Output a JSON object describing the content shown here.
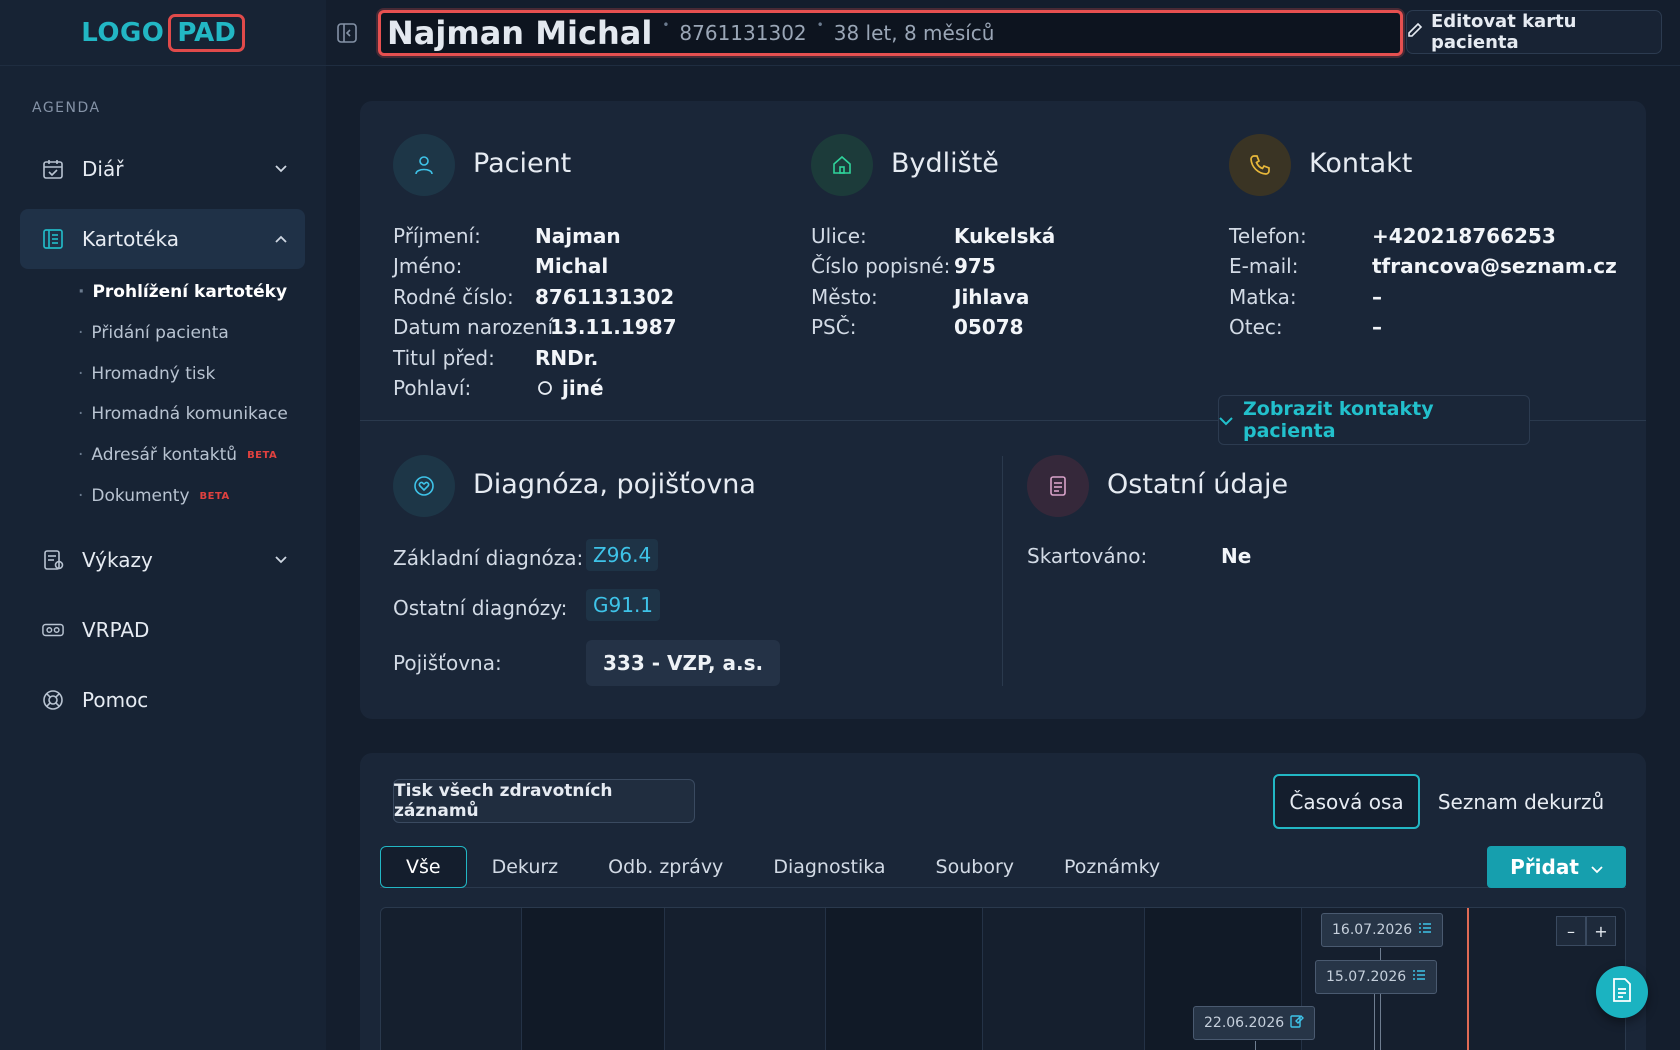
{
  "logo": {
    "part1": "LOGO",
    "part2": "PAD"
  },
  "sidebar": {
    "section": "AGENDA",
    "items": [
      {
        "label": "Diář"
      },
      {
        "label": "Kartotéka"
      },
      {
        "label": "Výkazy"
      },
      {
        "label": "VRPAD"
      },
      {
        "label": "Pomoc"
      }
    ],
    "subitems": [
      {
        "label": "Prohlížení kartotéky"
      },
      {
        "label": "Přidání pacienta"
      },
      {
        "label": "Hromadný tisk"
      },
      {
        "label": "Hromadná komunikace"
      },
      {
        "label": "Adresář kontaktů",
        "badge": "BETA"
      },
      {
        "label": "Dokumenty",
        "badge": "BETA"
      }
    ]
  },
  "header": {
    "name": "Najman Michal",
    "id": "8761131302",
    "age": "38 let, 8 měsíců",
    "edit_label": "Editovat kartu pacienta"
  },
  "patient": {
    "title": "Pacient",
    "rows": [
      {
        "label": "Příjmení:",
        "value": "Najman"
      },
      {
        "label": "Jméno:",
        "value": "Michal"
      },
      {
        "label": "Rodné číslo:",
        "value": "8761131302"
      },
      {
        "label": "Datum narození:",
        "value": "13.11.1987"
      },
      {
        "label": "Titul před:",
        "value": "RNDr."
      },
      {
        "label": "Pohlaví:",
        "value": "jiné"
      }
    ]
  },
  "residence": {
    "title": "Bydliště",
    "rows": [
      {
        "label": "Ulice:",
        "value": "Kukelská"
      },
      {
        "label": "Číslo popisné:",
        "value": "975"
      },
      {
        "label": "Město:",
        "value": "Jihlava"
      },
      {
        "label": "PSČ:",
        "value": "05078"
      }
    ]
  },
  "contact": {
    "title": "Kontakt",
    "rows": [
      {
        "label": "Telefon:",
        "value": "+420218766253"
      },
      {
        "label": "E-mail:",
        "value": "tfrancova@seznam.cz"
      },
      {
        "label": "Matka:",
        "value": "–"
      },
      {
        "label": "Otec:",
        "value": "–"
      }
    ],
    "show_contacts": "Zobrazit kontakty pacienta"
  },
  "diagnosis": {
    "title": "Diagnóza, pojišťovna",
    "base_label": "Základní diagnóza:",
    "base_value": "Z96.4",
    "other_label": "Ostatní diagnózy:",
    "other_value": "G91.1",
    "insurance_label": "Pojišťovna:",
    "insurance_value": "333 - VZP, a.s."
  },
  "other": {
    "title": "Ostatní údaje",
    "shredded_label": "Skartováno:",
    "shredded_value": "Ne"
  },
  "records": {
    "print_all": "Tisk všech zdravotních záznamů",
    "view_timeline": "Časová osa",
    "view_list": "Seznam dekurzů",
    "filters": [
      "Vše",
      "Dekurz",
      "Odb. zprávy",
      "Diagnostika",
      "Soubory",
      "Poznámky"
    ],
    "add_label": "Přidat",
    "events": [
      "16.07.2026",
      "15.07.2026",
      "22.06.2026"
    ],
    "zoom_out": "–",
    "zoom_in": "+"
  },
  "colors": {
    "accent": "#22b7c4",
    "highlight": "#e65050"
  }
}
